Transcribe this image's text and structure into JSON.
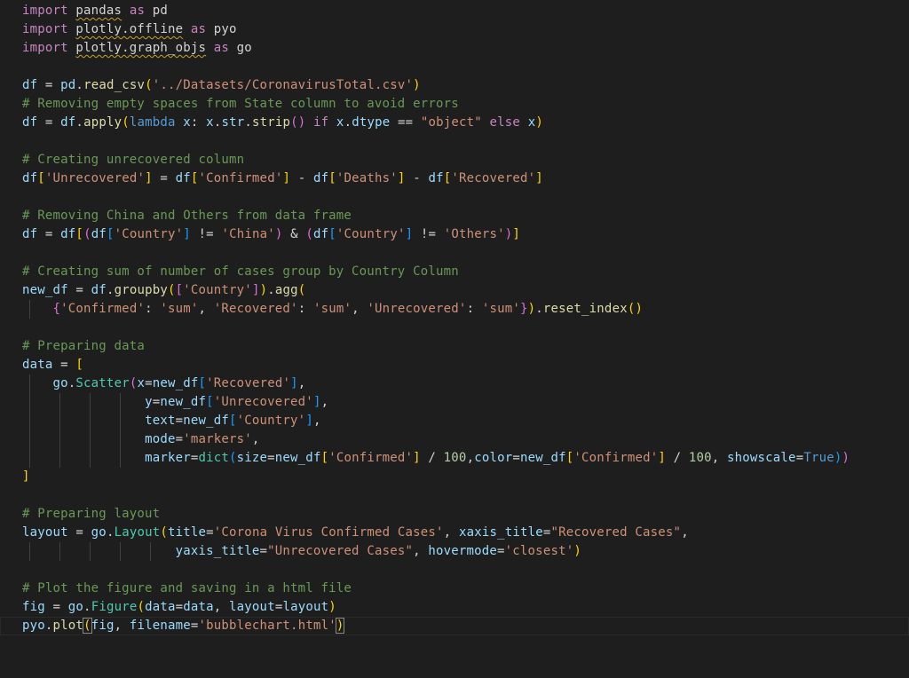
{
  "editor": {
    "language": "python",
    "colors": {
      "background": "#1e1e1e",
      "keyword": "#c586c0",
      "string": "#ce9178",
      "comment": "#6a9955",
      "function": "#dcdcaa",
      "variable": "#9cdcfe",
      "number": "#b5cea8"
    },
    "lines": [
      [
        {
          "c": "kw",
          "t": "import "
        },
        {
          "c": "mod squig",
          "t": "pandas"
        },
        {
          "c": "kw",
          "t": " as "
        },
        {
          "c": "mod",
          "t": "pd"
        }
      ],
      [
        {
          "c": "kw",
          "t": "import "
        },
        {
          "c": "mod squig",
          "t": "plotly.offline"
        },
        {
          "c": "kw",
          "t": " as "
        },
        {
          "c": "mod",
          "t": "pyo"
        }
      ],
      [
        {
          "c": "kw",
          "t": "import "
        },
        {
          "c": "mod squig",
          "t": "plotly.graph_objs"
        },
        {
          "c": "kw",
          "t": " as "
        },
        {
          "c": "mod",
          "t": "go"
        }
      ],
      [],
      [
        {
          "c": "var",
          "t": "df"
        },
        {
          "c": "op",
          "t": " = "
        },
        {
          "c": "var",
          "t": "pd"
        },
        {
          "c": "op",
          "t": "."
        },
        {
          "c": "fn",
          "t": "read_csv"
        },
        {
          "c": "br1",
          "t": "("
        },
        {
          "c": "str",
          "t": "'../Datasets/CoronavirusTotal.csv'"
        },
        {
          "c": "br1",
          "t": ")"
        }
      ],
      [
        {
          "c": "cm",
          "t": "# Removing empty spaces from State column to avoid errors"
        }
      ],
      [
        {
          "c": "var",
          "t": "df"
        },
        {
          "c": "op",
          "t": " = "
        },
        {
          "c": "var",
          "t": "df"
        },
        {
          "c": "op",
          "t": "."
        },
        {
          "c": "fn",
          "t": "apply"
        },
        {
          "c": "br1",
          "t": "("
        },
        {
          "c": "kw2",
          "t": "lambda"
        },
        {
          "c": "var",
          "t": " x"
        },
        {
          "c": "op",
          "t": ": "
        },
        {
          "c": "var",
          "t": "x"
        },
        {
          "c": "op",
          "t": "."
        },
        {
          "c": "var",
          "t": "str"
        },
        {
          "c": "op",
          "t": "."
        },
        {
          "c": "fn",
          "t": "strip"
        },
        {
          "c": "br2",
          "t": "()"
        },
        {
          "c": "kw",
          "t": " if "
        },
        {
          "c": "var",
          "t": "x"
        },
        {
          "c": "op",
          "t": "."
        },
        {
          "c": "var",
          "t": "dtype"
        },
        {
          "c": "op",
          "t": " == "
        },
        {
          "c": "str",
          "t": "\"object\""
        },
        {
          "c": "kw",
          "t": " else "
        },
        {
          "c": "var",
          "t": "x"
        },
        {
          "c": "br1",
          "t": ")"
        }
      ],
      [],
      [
        {
          "c": "cm",
          "t": "# Creating unrecovered column"
        }
      ],
      [
        {
          "c": "var",
          "t": "df"
        },
        {
          "c": "br1",
          "t": "["
        },
        {
          "c": "str",
          "t": "'Unrecovered'"
        },
        {
          "c": "br1",
          "t": "]"
        },
        {
          "c": "op",
          "t": " = "
        },
        {
          "c": "var",
          "t": "df"
        },
        {
          "c": "br1",
          "t": "["
        },
        {
          "c": "str",
          "t": "'Confirmed'"
        },
        {
          "c": "br1",
          "t": "]"
        },
        {
          "c": "op",
          "t": " - "
        },
        {
          "c": "var",
          "t": "df"
        },
        {
          "c": "br1",
          "t": "["
        },
        {
          "c": "str",
          "t": "'Deaths'"
        },
        {
          "c": "br1",
          "t": "]"
        },
        {
          "c": "op",
          "t": " - "
        },
        {
          "c": "var",
          "t": "df"
        },
        {
          "c": "br1",
          "t": "["
        },
        {
          "c": "str",
          "t": "'Recovered'"
        },
        {
          "c": "br1",
          "t": "]"
        }
      ],
      [],
      [
        {
          "c": "cm",
          "t": "# Removing China and Others from data frame"
        }
      ],
      [
        {
          "c": "var",
          "t": "df"
        },
        {
          "c": "op",
          "t": " = "
        },
        {
          "c": "var",
          "t": "df"
        },
        {
          "c": "br1",
          "t": "["
        },
        {
          "c": "br2",
          "t": "("
        },
        {
          "c": "var",
          "t": "df"
        },
        {
          "c": "br3",
          "t": "["
        },
        {
          "c": "str",
          "t": "'Country'"
        },
        {
          "c": "br3",
          "t": "]"
        },
        {
          "c": "op",
          "t": " != "
        },
        {
          "c": "str",
          "t": "'China'"
        },
        {
          "c": "br2",
          "t": ")"
        },
        {
          "c": "op",
          "t": " & "
        },
        {
          "c": "br2",
          "t": "("
        },
        {
          "c": "var",
          "t": "df"
        },
        {
          "c": "br3",
          "t": "["
        },
        {
          "c": "str",
          "t": "'Country'"
        },
        {
          "c": "br3",
          "t": "]"
        },
        {
          "c": "op",
          "t": " != "
        },
        {
          "c": "str",
          "t": "'Others'"
        },
        {
          "c": "br2",
          "t": ")"
        },
        {
          "c": "br1",
          "t": "]"
        }
      ],
      [],
      [
        {
          "c": "cm",
          "t": "# Creating sum of number of cases group by Country Column"
        }
      ],
      [
        {
          "c": "var",
          "t": "new_df"
        },
        {
          "c": "op",
          "t": " = "
        },
        {
          "c": "var",
          "t": "df"
        },
        {
          "c": "op",
          "t": "."
        },
        {
          "c": "fn",
          "t": "groupby"
        },
        {
          "c": "br1",
          "t": "("
        },
        {
          "c": "br2",
          "t": "["
        },
        {
          "c": "str",
          "t": "'Country'"
        },
        {
          "c": "br2",
          "t": "]"
        },
        {
          "c": "br1",
          "t": ")"
        },
        {
          "c": "op",
          "t": "."
        },
        {
          "c": "fn",
          "t": "agg"
        },
        {
          "c": "br1",
          "t": "("
        }
      ],
      [
        {
          "c": "op",
          "t": "    "
        },
        {
          "c": "br2",
          "t": "{"
        },
        {
          "c": "str",
          "t": "'Confirmed'"
        },
        {
          "c": "op",
          "t": ": "
        },
        {
          "c": "str",
          "t": "'sum'"
        },
        {
          "c": "op",
          "t": ", "
        },
        {
          "c": "str",
          "t": "'Recovered'"
        },
        {
          "c": "op",
          "t": ": "
        },
        {
          "c": "str",
          "t": "'sum'"
        },
        {
          "c": "op",
          "t": ", "
        },
        {
          "c": "str",
          "t": "'Unrecovered'"
        },
        {
          "c": "op",
          "t": ": "
        },
        {
          "c": "str",
          "t": "'sum'"
        },
        {
          "c": "br2",
          "t": "}"
        },
        {
          "c": "br1",
          "t": ")"
        },
        {
          "c": "op",
          "t": "."
        },
        {
          "c": "fn",
          "t": "reset_index"
        },
        {
          "c": "br1",
          "t": "()"
        }
      ],
      [],
      [
        {
          "c": "cm",
          "t": "# Preparing data"
        }
      ],
      [
        {
          "c": "var",
          "t": "data"
        },
        {
          "c": "op",
          "t": " = "
        },
        {
          "c": "br1",
          "t": "["
        }
      ],
      [
        {
          "c": "op",
          "t": "    "
        },
        {
          "c": "var",
          "t": "go"
        },
        {
          "c": "op",
          "t": "."
        },
        {
          "c": "cls",
          "t": "Scatter"
        },
        {
          "c": "br2",
          "t": "("
        },
        {
          "c": "var",
          "t": "x"
        },
        {
          "c": "op",
          "t": "="
        },
        {
          "c": "var",
          "t": "new_df"
        },
        {
          "c": "br3",
          "t": "["
        },
        {
          "c": "str",
          "t": "'Recovered'"
        },
        {
          "c": "br3",
          "t": "]"
        },
        {
          "c": "op",
          "t": ","
        }
      ],
      [
        {
          "c": "op",
          "t": "                "
        },
        {
          "c": "var",
          "t": "y"
        },
        {
          "c": "op",
          "t": "="
        },
        {
          "c": "var",
          "t": "new_df"
        },
        {
          "c": "br3",
          "t": "["
        },
        {
          "c": "str",
          "t": "'Unrecovered'"
        },
        {
          "c": "br3",
          "t": "]"
        },
        {
          "c": "op",
          "t": ","
        }
      ],
      [
        {
          "c": "op",
          "t": "                "
        },
        {
          "c": "var",
          "t": "text"
        },
        {
          "c": "op",
          "t": "="
        },
        {
          "c": "var",
          "t": "new_df"
        },
        {
          "c": "br3",
          "t": "["
        },
        {
          "c": "str",
          "t": "'Country'"
        },
        {
          "c": "br3",
          "t": "]"
        },
        {
          "c": "op",
          "t": ","
        }
      ],
      [
        {
          "c": "op",
          "t": "                "
        },
        {
          "c": "var",
          "t": "mode"
        },
        {
          "c": "op",
          "t": "="
        },
        {
          "c": "str",
          "t": "'markers'"
        },
        {
          "c": "op",
          "t": ","
        }
      ],
      [
        {
          "c": "op",
          "t": "                "
        },
        {
          "c": "var",
          "t": "marker"
        },
        {
          "c": "op",
          "t": "="
        },
        {
          "c": "cls",
          "t": "dict"
        },
        {
          "c": "br3",
          "t": "("
        },
        {
          "c": "var",
          "t": "size"
        },
        {
          "c": "op",
          "t": "="
        },
        {
          "c": "var",
          "t": "new_df"
        },
        {
          "c": "br1",
          "t": "["
        },
        {
          "c": "str",
          "t": "'Confirmed'"
        },
        {
          "c": "br1",
          "t": "]"
        },
        {
          "c": "op",
          "t": " / "
        },
        {
          "c": "num",
          "t": "100"
        },
        {
          "c": "op",
          "t": ","
        },
        {
          "c": "var",
          "t": "color"
        },
        {
          "c": "op",
          "t": "="
        },
        {
          "c": "var",
          "t": "new_df"
        },
        {
          "c": "br1",
          "t": "["
        },
        {
          "c": "str",
          "t": "'Confirmed'"
        },
        {
          "c": "br1",
          "t": "]"
        },
        {
          "c": "op",
          "t": " / "
        },
        {
          "c": "num",
          "t": "100"
        },
        {
          "c": "op",
          "t": ", "
        },
        {
          "c": "var",
          "t": "showscale"
        },
        {
          "c": "op",
          "t": "="
        },
        {
          "c": "kw2",
          "t": "True"
        },
        {
          "c": "br3",
          "t": ")"
        },
        {
          "c": "br2",
          "t": ")"
        }
      ],
      [
        {
          "c": "br1",
          "t": "]"
        }
      ],
      [],
      [
        {
          "c": "cm",
          "t": "# Preparing layout"
        }
      ],
      [
        {
          "c": "var",
          "t": "layout"
        },
        {
          "c": "op",
          "t": " = "
        },
        {
          "c": "var",
          "t": "go"
        },
        {
          "c": "op",
          "t": "."
        },
        {
          "c": "cls",
          "t": "Layout"
        },
        {
          "c": "br1",
          "t": "("
        },
        {
          "c": "var",
          "t": "title"
        },
        {
          "c": "op",
          "t": "="
        },
        {
          "c": "str",
          "t": "'Corona Virus Confirmed Cases'"
        },
        {
          "c": "op",
          "t": ", "
        },
        {
          "c": "var",
          "t": "xaxis_title"
        },
        {
          "c": "op",
          "t": "="
        },
        {
          "c": "str",
          "t": "\"Recovered Cases\""
        },
        {
          "c": "op",
          "t": ","
        }
      ],
      [
        {
          "c": "op",
          "t": "                    "
        },
        {
          "c": "var",
          "t": "yaxis_title"
        },
        {
          "c": "op",
          "t": "="
        },
        {
          "c": "str",
          "t": "\"Unrecovered Cases\""
        },
        {
          "c": "op",
          "t": ", "
        },
        {
          "c": "var",
          "t": "hovermode"
        },
        {
          "c": "op",
          "t": "="
        },
        {
          "c": "str",
          "t": "'closest'"
        },
        {
          "c": "br1",
          "t": ")"
        }
      ],
      [],
      [
        {
          "c": "cm",
          "t": "# Plot the figure and saving in a html file"
        }
      ],
      [
        {
          "c": "var",
          "t": "fig"
        },
        {
          "c": "op",
          "t": " = "
        },
        {
          "c": "var",
          "t": "go"
        },
        {
          "c": "op",
          "t": "."
        },
        {
          "c": "cls",
          "t": "Figure"
        },
        {
          "c": "br1",
          "t": "("
        },
        {
          "c": "var",
          "t": "data"
        },
        {
          "c": "op",
          "t": "="
        },
        {
          "c": "var",
          "t": "data"
        },
        {
          "c": "op",
          "t": ", "
        },
        {
          "c": "var",
          "t": "layout"
        },
        {
          "c": "op",
          "t": "="
        },
        {
          "c": "var",
          "t": "layout"
        },
        {
          "c": "br1",
          "t": ")"
        }
      ],
      [
        {
          "c": "var",
          "t": "pyo"
        },
        {
          "c": "op",
          "t": "."
        },
        {
          "c": "fn",
          "t": "plot"
        },
        {
          "c": "br1 cursor-box",
          "t": "("
        },
        {
          "c": "var",
          "t": "fig"
        },
        {
          "c": "op",
          "t": ", "
        },
        {
          "c": "var",
          "t": "filename"
        },
        {
          "c": "op",
          "t": "="
        },
        {
          "c": "str",
          "t": "'bubblechart.html'"
        },
        {
          "c": "br1 cursor-box",
          "t": ")"
        }
      ]
    ]
  }
}
